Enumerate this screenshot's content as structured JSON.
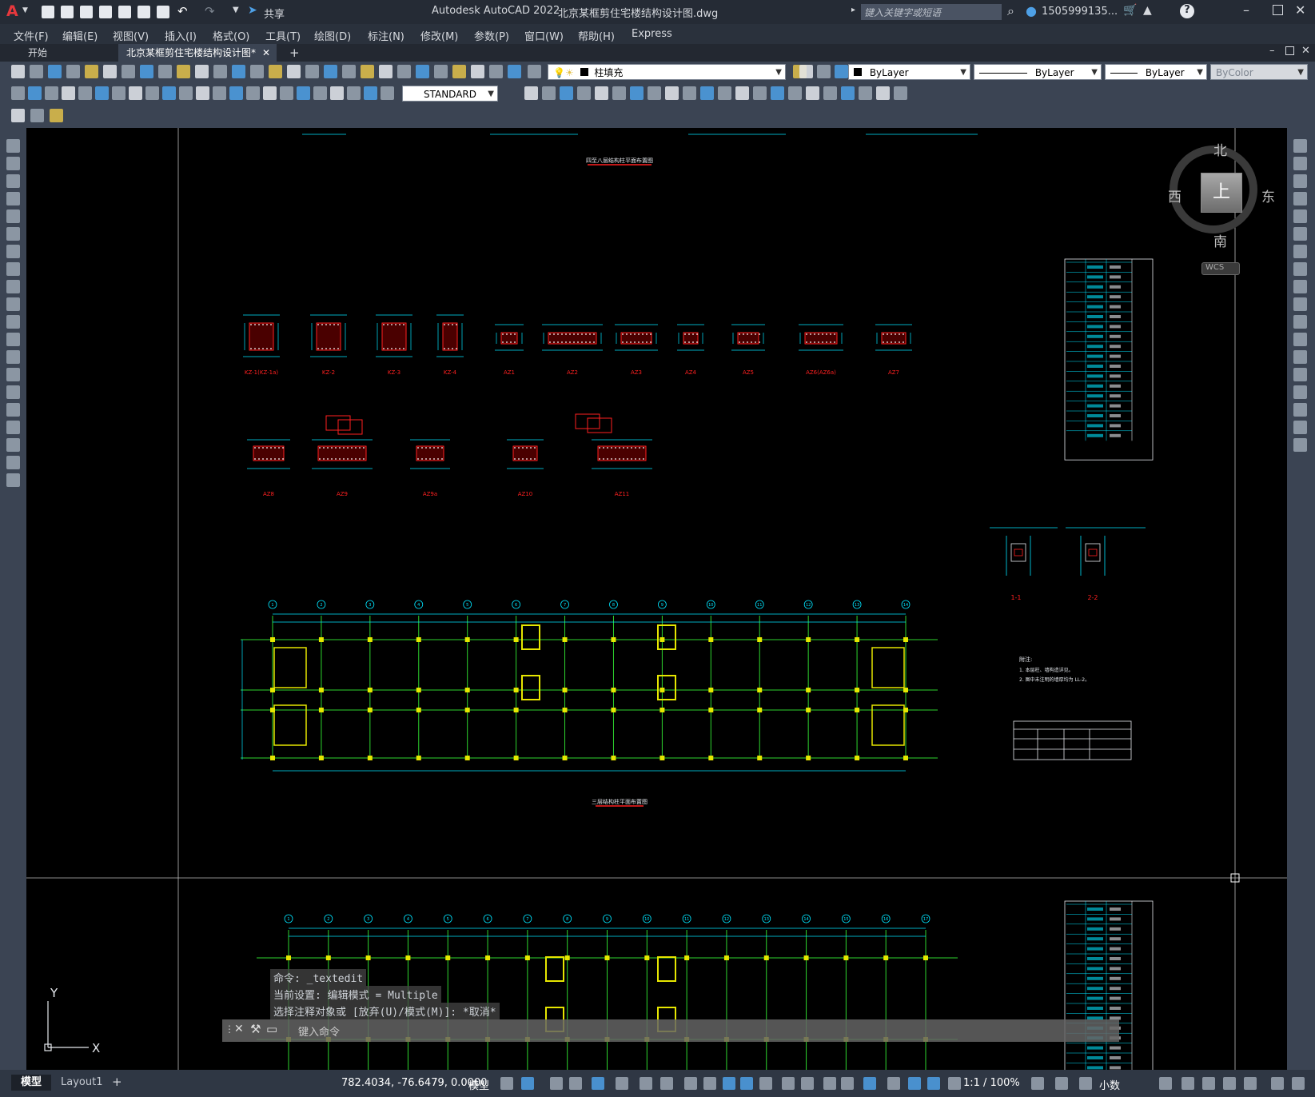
{
  "app_logo": "A",
  "title": {
    "app": "Autodesk AutoCAD 2022",
    "file": "北京某框剪住宅楼结构设计图.dwg",
    "share_label": "共享",
    "search_placeholder": "键入关键字或短语",
    "user": "1505999135...",
    "help": "?"
  },
  "menu": [
    "文件(F)",
    "编辑(E)",
    "视图(V)",
    "插入(I)",
    "格式(O)",
    "工具(T)",
    "绘图(D)",
    "标注(N)",
    "修改(M)",
    "参数(P)",
    "窗口(W)",
    "帮助(H)",
    "Express"
  ],
  "tabs": {
    "start": "开始",
    "doc": "北京某框剪住宅楼结构设计图*",
    "close": "✕",
    "add": "+"
  },
  "toolbar": {
    "layer": "柱填充",
    "color": "ByLayer",
    "linetype": "ByLayer",
    "lineweight": "ByLayer",
    "plotstyle": "ByColor",
    "textstyle": "STANDARD"
  },
  "viewcube": {
    "north": "北",
    "south": "南",
    "east": "东",
    "west": "西",
    "top": "上",
    "wcs": "WCS"
  },
  "drawing": {
    "title1": "四至八层结构柱平面布置图",
    "title2": "三层结构柱平面布置图",
    "column_labels_row1": [
      "KZ-1(KZ-1a)",
      "KZ-2",
      "KZ-3",
      "KZ-4",
      "AZ1",
      "AZ2",
      "AZ3",
      "AZ4",
      "AZ5",
      "AZ6(AZ6a)",
      "AZ7"
    ],
    "column_labels_row2": [
      "AZ8",
      "AZ9",
      "AZ9a",
      "AZ10",
      "AZ11"
    ],
    "section_labels": [
      "1-1",
      "2-2"
    ],
    "notes_title": "附注:",
    "notes": [
      "1. 本层柱、墙构造详见。",
      "2. 图中未注明的墙厚均为 LL-2。"
    ],
    "axis_labels": [
      "1",
      "2",
      "3",
      "4",
      "5",
      "6",
      "7",
      "8",
      "9",
      "10",
      "11",
      "12",
      "13",
      "14",
      "15",
      "16",
      "17"
    ],
    "ucs_x": "X",
    "ucs_y": "Y"
  },
  "command": {
    "line1": "命令: _textedit",
    "line2": "当前设置: 编辑模式 = Multiple",
    "line3": "选择注释对象或 [放弃(U)/模式(M)]: *取消*",
    "input_placeholder": "键入命令"
  },
  "status": {
    "model_tab": "模型",
    "layout_tab": "Layout1",
    "add_tab": "+",
    "coords": "782.4034, -76.6479, 0.0000",
    "model_label": "模型",
    "scale": "1:1 / 100%",
    "units": "小数"
  },
  "colors": {
    "accent": "#4ea0e6",
    "cyan": "#00e5ff",
    "red": "#ff2020",
    "yellow": "#e6e600",
    "green": "#2ed52e"
  }
}
